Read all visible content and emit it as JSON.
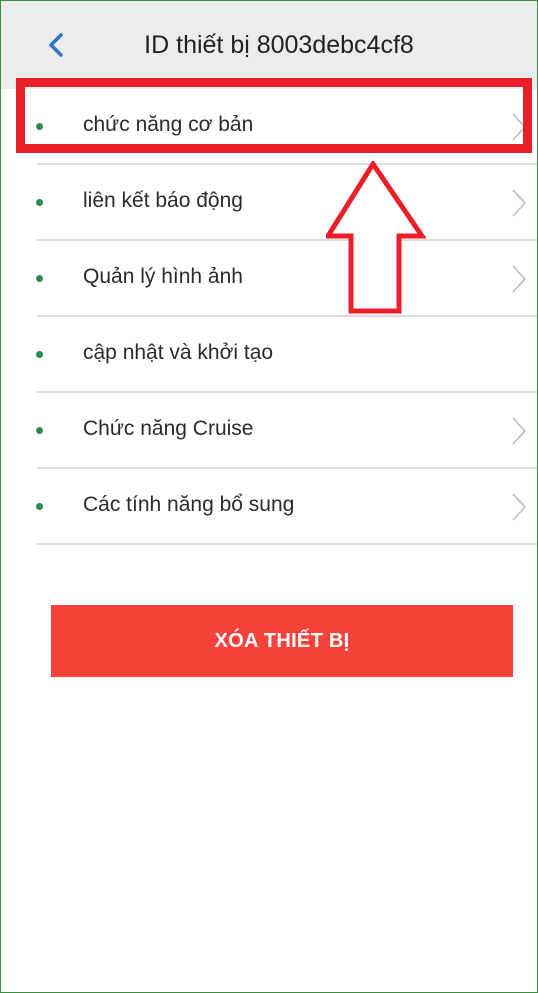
{
  "header": {
    "title": "ID thiết bị  8003debc4cf8",
    "back_icon": "chevron-left-icon",
    "accent_color": "#2b76c8"
  },
  "menu": {
    "items": [
      {
        "label": "chức năng cơ bản",
        "has_chevron": true
      },
      {
        "label": "liên kết báo động",
        "has_chevron": true
      },
      {
        "label": "Quản lý hình ảnh",
        "has_chevron": true
      },
      {
        "label": "cập nhật và khởi tạo",
        "has_chevron": false
      },
      {
        "label": "Chức năng Cruise",
        "has_chevron": true
      },
      {
        "label": "Các tính năng bổ sung",
        "has_chevron": true
      }
    ],
    "bullet_color": "#2a8a57"
  },
  "annotation": {
    "highlight_color": "#ea1f29",
    "pointer_icon": "up-arrow-icon"
  },
  "actions": {
    "delete_label": "XÓA THIẾT BỊ",
    "delete_color": "#f7413b"
  }
}
